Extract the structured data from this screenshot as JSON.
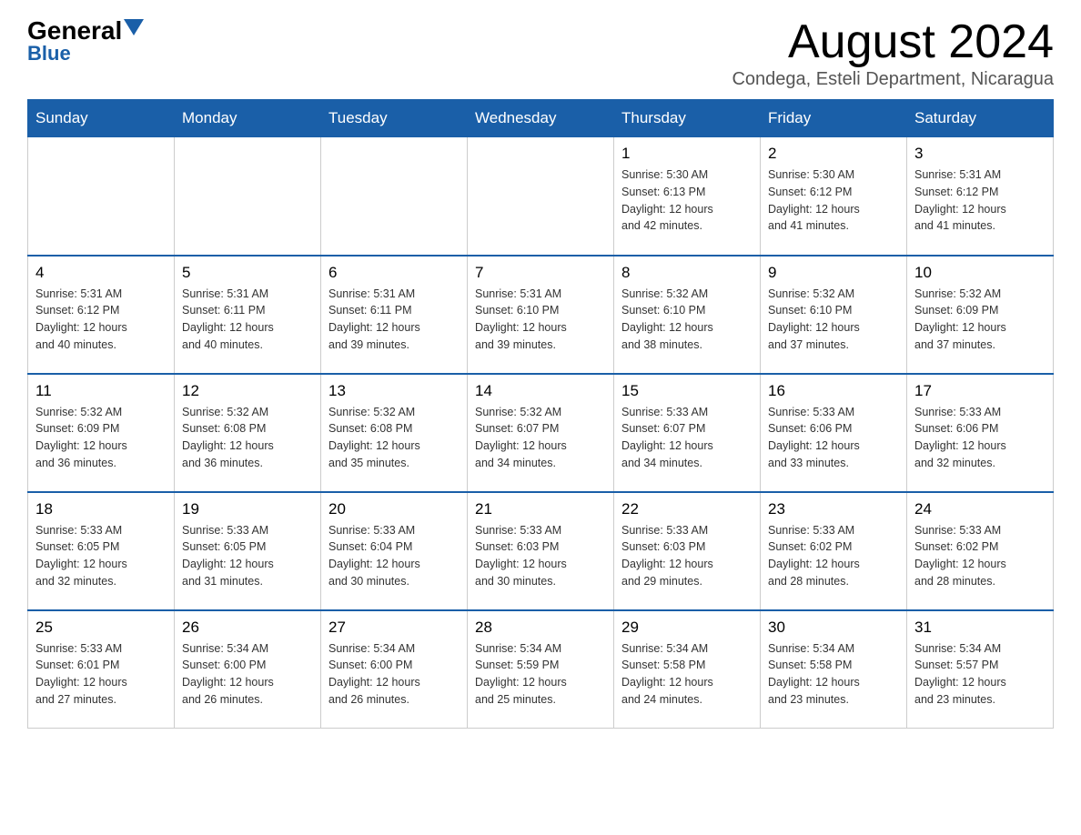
{
  "header": {
    "logo_general": "General",
    "logo_blue": "Blue",
    "month_year": "August 2024",
    "location": "Condega, Esteli Department, Nicaragua"
  },
  "weekdays": [
    "Sunday",
    "Monday",
    "Tuesday",
    "Wednesday",
    "Thursday",
    "Friday",
    "Saturday"
  ],
  "weeks": [
    [
      {
        "day": "",
        "info": ""
      },
      {
        "day": "",
        "info": ""
      },
      {
        "day": "",
        "info": ""
      },
      {
        "day": "",
        "info": ""
      },
      {
        "day": "1",
        "info": "Sunrise: 5:30 AM\nSunset: 6:13 PM\nDaylight: 12 hours\nand 42 minutes."
      },
      {
        "day": "2",
        "info": "Sunrise: 5:30 AM\nSunset: 6:12 PM\nDaylight: 12 hours\nand 41 minutes."
      },
      {
        "day": "3",
        "info": "Sunrise: 5:31 AM\nSunset: 6:12 PM\nDaylight: 12 hours\nand 41 minutes."
      }
    ],
    [
      {
        "day": "4",
        "info": "Sunrise: 5:31 AM\nSunset: 6:12 PM\nDaylight: 12 hours\nand 40 minutes."
      },
      {
        "day": "5",
        "info": "Sunrise: 5:31 AM\nSunset: 6:11 PM\nDaylight: 12 hours\nand 40 minutes."
      },
      {
        "day": "6",
        "info": "Sunrise: 5:31 AM\nSunset: 6:11 PM\nDaylight: 12 hours\nand 39 minutes."
      },
      {
        "day": "7",
        "info": "Sunrise: 5:31 AM\nSunset: 6:10 PM\nDaylight: 12 hours\nand 39 minutes."
      },
      {
        "day": "8",
        "info": "Sunrise: 5:32 AM\nSunset: 6:10 PM\nDaylight: 12 hours\nand 38 minutes."
      },
      {
        "day": "9",
        "info": "Sunrise: 5:32 AM\nSunset: 6:10 PM\nDaylight: 12 hours\nand 37 minutes."
      },
      {
        "day": "10",
        "info": "Sunrise: 5:32 AM\nSunset: 6:09 PM\nDaylight: 12 hours\nand 37 minutes."
      }
    ],
    [
      {
        "day": "11",
        "info": "Sunrise: 5:32 AM\nSunset: 6:09 PM\nDaylight: 12 hours\nand 36 minutes."
      },
      {
        "day": "12",
        "info": "Sunrise: 5:32 AM\nSunset: 6:08 PM\nDaylight: 12 hours\nand 36 minutes."
      },
      {
        "day": "13",
        "info": "Sunrise: 5:32 AM\nSunset: 6:08 PM\nDaylight: 12 hours\nand 35 minutes."
      },
      {
        "day": "14",
        "info": "Sunrise: 5:32 AM\nSunset: 6:07 PM\nDaylight: 12 hours\nand 34 minutes."
      },
      {
        "day": "15",
        "info": "Sunrise: 5:33 AM\nSunset: 6:07 PM\nDaylight: 12 hours\nand 34 minutes."
      },
      {
        "day": "16",
        "info": "Sunrise: 5:33 AM\nSunset: 6:06 PM\nDaylight: 12 hours\nand 33 minutes."
      },
      {
        "day": "17",
        "info": "Sunrise: 5:33 AM\nSunset: 6:06 PM\nDaylight: 12 hours\nand 32 minutes."
      }
    ],
    [
      {
        "day": "18",
        "info": "Sunrise: 5:33 AM\nSunset: 6:05 PM\nDaylight: 12 hours\nand 32 minutes."
      },
      {
        "day": "19",
        "info": "Sunrise: 5:33 AM\nSunset: 6:05 PM\nDaylight: 12 hours\nand 31 minutes."
      },
      {
        "day": "20",
        "info": "Sunrise: 5:33 AM\nSunset: 6:04 PM\nDaylight: 12 hours\nand 30 minutes."
      },
      {
        "day": "21",
        "info": "Sunrise: 5:33 AM\nSunset: 6:03 PM\nDaylight: 12 hours\nand 30 minutes."
      },
      {
        "day": "22",
        "info": "Sunrise: 5:33 AM\nSunset: 6:03 PM\nDaylight: 12 hours\nand 29 minutes."
      },
      {
        "day": "23",
        "info": "Sunrise: 5:33 AM\nSunset: 6:02 PM\nDaylight: 12 hours\nand 28 minutes."
      },
      {
        "day": "24",
        "info": "Sunrise: 5:33 AM\nSunset: 6:02 PM\nDaylight: 12 hours\nand 28 minutes."
      }
    ],
    [
      {
        "day": "25",
        "info": "Sunrise: 5:33 AM\nSunset: 6:01 PM\nDaylight: 12 hours\nand 27 minutes."
      },
      {
        "day": "26",
        "info": "Sunrise: 5:34 AM\nSunset: 6:00 PM\nDaylight: 12 hours\nand 26 minutes."
      },
      {
        "day": "27",
        "info": "Sunrise: 5:34 AM\nSunset: 6:00 PM\nDaylight: 12 hours\nand 26 minutes."
      },
      {
        "day": "28",
        "info": "Sunrise: 5:34 AM\nSunset: 5:59 PM\nDaylight: 12 hours\nand 25 minutes."
      },
      {
        "day": "29",
        "info": "Sunrise: 5:34 AM\nSunset: 5:58 PM\nDaylight: 12 hours\nand 24 minutes."
      },
      {
        "day": "30",
        "info": "Sunrise: 5:34 AM\nSunset: 5:58 PM\nDaylight: 12 hours\nand 23 minutes."
      },
      {
        "day": "31",
        "info": "Sunrise: 5:34 AM\nSunset: 5:57 PM\nDaylight: 12 hours\nand 23 minutes."
      }
    ]
  ]
}
